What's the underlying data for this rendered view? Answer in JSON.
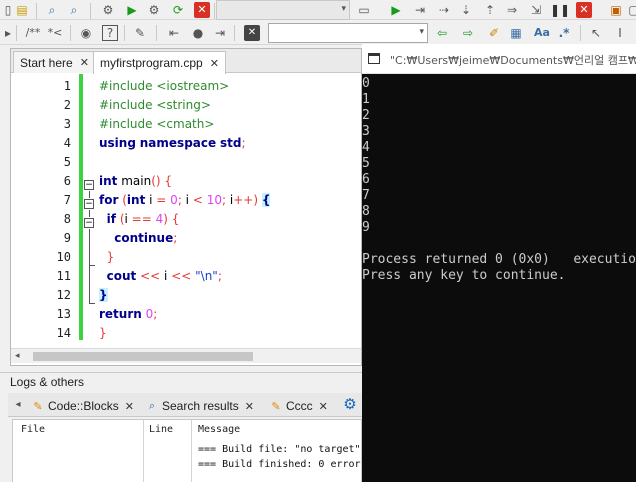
{
  "editor": {
    "tabs": [
      {
        "label": "Start here",
        "close": "✕"
      },
      {
        "label": "myfirstprogram.cpp",
        "close": "✕"
      }
    ],
    "line_numbers": [
      "1",
      "2",
      "3",
      "4",
      "5",
      "6",
      "7",
      "8",
      "9",
      "10",
      "11",
      "12",
      "13",
      "14"
    ]
  },
  "logs": {
    "title": "Logs & others",
    "tabs": [
      {
        "label": "Code::Blocks",
        "close": "✕"
      },
      {
        "label": "Search results",
        "close": "✕"
      },
      {
        "label": "Cccc",
        "close": "✕"
      }
    ],
    "columns": {
      "file": "File",
      "line": "Line",
      "message": "Message"
    },
    "rows": [
      {
        "message": "=== Build file: \"no target\""
      },
      {
        "message": "=== Build finished: 0 error"
      }
    ]
  },
  "console": {
    "title": "\"C:₩Users₩jeime₩Documents₩언리얼 캠프₩C",
    "lines": [
      "0",
      "1",
      "2",
      "3",
      "4",
      "5",
      "6",
      "7",
      "8",
      "9",
      "",
      "Process returned 0 (0x0)   executio",
      "Press any key to continue."
    ]
  },
  "colors": {
    "change_bar": "#3fd23f",
    "console_bg": "#0c0c0c",
    "console_text": "#cccccc",
    "keyword": "#00008b",
    "preprocessor": "#2e8b2e",
    "number": "#e040fb"
  },
  "icons": [
    "folder-icon",
    "save-icon",
    "search-icon",
    "gear-icon",
    "play-icon",
    "build-run-icon",
    "rebuild-icon",
    "abort-icon",
    "comment-icon",
    "uncomment-icon",
    "jump-back-icon",
    "jump-forward-icon",
    "clear-icon",
    "highlight-icon",
    "regex-icon",
    "select-icon",
    "fold-collapse-icon",
    "log-page-icon",
    "settings-gear-icon",
    "console-window-icon"
  ]
}
